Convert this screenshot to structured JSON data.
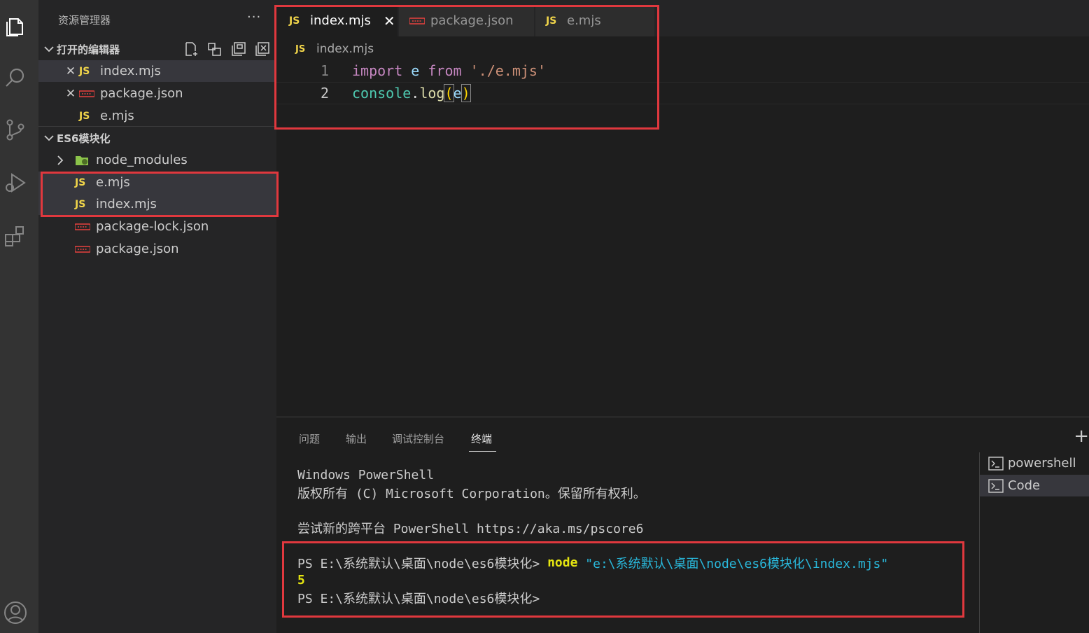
{
  "sidebar": {
    "title": "资源管理器",
    "more": "···",
    "open_editors": {
      "label": "打开的编辑器",
      "items": [
        {
          "name": "index.mjs",
          "type": "JS"
        },
        {
          "name": "package.json",
          "type": "json"
        },
        {
          "name": "e.mjs",
          "type": "JS"
        }
      ]
    },
    "project": {
      "label": "ES6模块化",
      "items": [
        {
          "name": "node_modules",
          "type": "folder"
        },
        {
          "name": "e.mjs",
          "type": "JS"
        },
        {
          "name": "index.mjs",
          "type": "JS"
        },
        {
          "name": "package-lock.json",
          "type": "json"
        },
        {
          "name": "package.json",
          "type": "json"
        }
      ]
    }
  },
  "tabs": [
    {
      "label": "index.mjs",
      "icon": "JS",
      "active": true,
      "close": "✕"
    },
    {
      "label": "package.json",
      "icon": "json"
    },
    {
      "label": "e.mjs",
      "icon": "JS"
    }
  ],
  "breadcrumb": {
    "icon": "JS",
    "file": "index.mjs"
  },
  "editor": {
    "lines": [
      {
        "num": "1"
      },
      {
        "num": "2"
      }
    ],
    "tokens": {
      "import": "import",
      "e": "e",
      "from": "from",
      "path": "'./e.mjs'",
      "console": "console",
      "dot": ".",
      "log": "log",
      "lparen": "(",
      "arg": "e",
      "rparen": ")"
    }
  },
  "panel": {
    "tabs": [
      "问题",
      "输出",
      "调试控制台",
      "终端"
    ],
    "plus": "+",
    "terminal": {
      "l1": "Windows PowerShell",
      "l2": "版权所有 (C) Microsoft Corporation。保留所有权利。",
      "l3": "尝试新的跨平台 PowerShell https://aka.ms/pscore6",
      "l4_prompt": "PS E:\\系统默认\\桌面\\node\\es6模块化> ",
      "l4_cmd": "node",
      "l4_arg": " \"e:\\系统默认\\桌面\\node\\es6模块化\\index.mjs\"",
      "l5": "5",
      "l6": "PS E:\\系统默认\\桌面\\node\\es6模块化>"
    },
    "terminal_list": [
      "powershell",
      "Code"
    ]
  },
  "colors": {
    "highlight_box": "#e0383e",
    "js_icon": "#f1d54a",
    "keyword": "#c586c0"
  }
}
